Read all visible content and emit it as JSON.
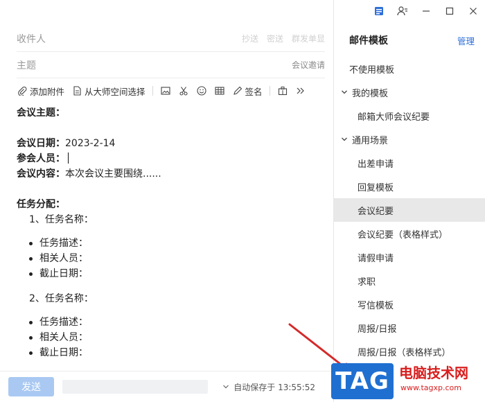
{
  "window": {
    "controls": [
      "calendar-icon",
      "contacts-icon",
      "minimize-icon",
      "maximize-icon",
      "close-icon"
    ]
  },
  "compose": {
    "to_placeholder": "收件人",
    "to_actions": [
      "抄送",
      "密送",
      "群发单显"
    ],
    "subject_placeholder": "主题",
    "subject_hint": "会议邀请",
    "toolbar": {
      "attach": "添加附件",
      "master_space": "从大师空间选择",
      "signature": "签名"
    },
    "body": {
      "topic_label": "会议主题：",
      "date_label": "会议日期：",
      "date_value": "2023-2-14",
      "attendees_label": "参会人员：",
      "content_label": "会议内容：",
      "content_value": "本次会议主要围绕......",
      "assign_label": "任务分配：",
      "tasks": [
        {
          "title": "1、任务名称：",
          "bullets": [
            "任务描述：",
            "相关人员：",
            "截止日期："
          ]
        },
        {
          "title": "2、任务名称：",
          "bullets": [
            "任务描述：",
            "相关人员：",
            "截止日期："
          ]
        }
      ]
    }
  },
  "bottom": {
    "send_label": "发送",
    "autosave_label": "自动保存于 13:55:52"
  },
  "panel": {
    "title": "邮件模板",
    "manage": "管理",
    "items": [
      {
        "label": "不使用模板",
        "level": "top"
      },
      {
        "label": "我的模板",
        "level": "group"
      },
      {
        "label": "邮箱大师会议纪要",
        "level": "child"
      },
      {
        "label": "通用场景",
        "level": "group"
      },
      {
        "label": "出差申请",
        "level": "child"
      },
      {
        "label": "回复模板",
        "level": "child"
      },
      {
        "label": "会议纪要",
        "level": "child",
        "active": true
      },
      {
        "label": "会议纪要（表格样式）",
        "level": "child"
      },
      {
        "label": "请假申请",
        "level": "child"
      },
      {
        "label": "求职",
        "level": "child"
      },
      {
        "label": "写信模板",
        "level": "child"
      },
      {
        "label": "周报/日报",
        "level": "child"
      },
      {
        "label": "周报/日报（表格样式）",
        "level": "child"
      }
    ]
  },
  "watermark": {
    "tag": "TAG",
    "site_name": "电脑技术网",
    "url": "www.tagxp.com"
  },
  "colors": {
    "accent": "#2f6fd8",
    "send_disabled": "#a9c9f2",
    "active_row": "#e8e8e8",
    "arrow": "#d42a2a"
  }
}
